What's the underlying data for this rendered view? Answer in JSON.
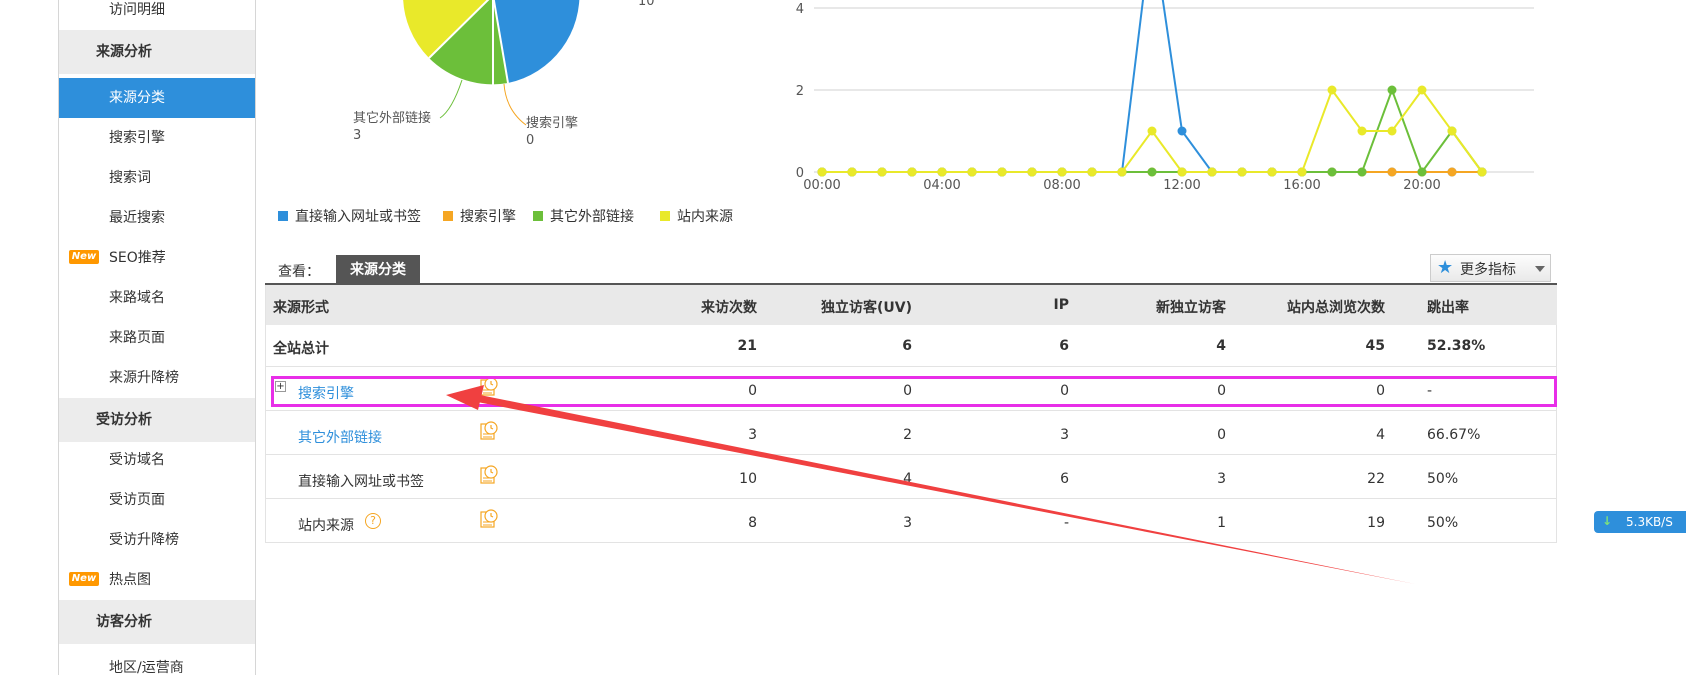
{
  "sidebar": {
    "items": [
      {
        "label": "访问明细",
        "type": "item"
      },
      {
        "label": "来源分析",
        "type": "group"
      },
      {
        "label": "来源分类",
        "type": "active"
      },
      {
        "label": "搜索引擎",
        "type": "item"
      },
      {
        "label": "搜索词",
        "type": "item"
      },
      {
        "label": "最近搜索",
        "type": "item"
      },
      {
        "label": "SEO推荐",
        "type": "new"
      },
      {
        "label": "来路域名",
        "type": "item"
      },
      {
        "label": "来路页面",
        "type": "item"
      },
      {
        "label": "来源升降榜",
        "type": "item"
      },
      {
        "label": "受访分析",
        "type": "group"
      },
      {
        "label": "受访域名",
        "type": "item"
      },
      {
        "label": "受访页面",
        "type": "item"
      },
      {
        "label": "受访升降榜",
        "type": "item"
      },
      {
        "label": "热点图",
        "type": "new"
      },
      {
        "label": "访客分析",
        "type": "group"
      },
      {
        "label": "地区/运营商",
        "type": "item"
      }
    ],
    "new_badge": "New"
  },
  "pie": {
    "labels": [
      {
        "name": "其它外部链接",
        "value": "3"
      },
      {
        "name": "搜索引擎",
        "value": "0"
      },
      {
        "name": "",
        "value": "10"
      }
    ]
  },
  "legend": [
    {
      "label": "直接输入网址或书签",
      "color": "#2e8fdb"
    },
    {
      "label": "搜索引擎",
      "color": "#f5a623"
    },
    {
      "label": "其它外部链接",
      "color": "#6cbf3a"
    },
    {
      "label": "站内来源",
      "color": "#e9e92a"
    }
  ],
  "chart_data": {
    "type": "line",
    "x": [
      "00:00",
      "01:00",
      "02:00",
      "03:00",
      "04:00",
      "05:00",
      "06:00",
      "07:00",
      "08:00",
      "09:00",
      "10:00",
      "11:00",
      "12:00",
      "13:00",
      "14:00",
      "15:00",
      "16:00",
      "17:00",
      "18:00",
      "19:00",
      "20:00",
      "21:00",
      "22:00"
    ],
    "xticks": [
      "00:00",
      "04:00",
      "08:00",
      "12:00",
      "16:00",
      "20:00"
    ],
    "yticks": [
      "0",
      "2",
      "4"
    ],
    "ylim": [
      0,
      4
    ],
    "series": [
      {
        "name": "直接输入网址或书签",
        "color": "#2e8fdb",
        "values": [
          0,
          0,
          0,
          0,
          0,
          0,
          0,
          0,
          0,
          0,
          0,
          6,
          1,
          0,
          0,
          0,
          0,
          0,
          0,
          0,
          0,
          0,
          0
        ]
      },
      {
        "name": "搜索引擎",
        "color": "#f5a623",
        "values": [
          0,
          0,
          0,
          0,
          0,
          0,
          0,
          0,
          0,
          0,
          0,
          0,
          0,
          0,
          0,
          0,
          0,
          0,
          0,
          0,
          0,
          0,
          0
        ]
      },
      {
        "name": "其它外部链接",
        "color": "#6cbf3a",
        "values": [
          0,
          0,
          0,
          0,
          0,
          0,
          0,
          0,
          0,
          0,
          0,
          0,
          0,
          0,
          0,
          0,
          0,
          0,
          0,
          2,
          0,
          1,
          0
        ]
      },
      {
        "name": "站内来源",
        "color": "#e9e92a",
        "values": [
          0,
          0,
          0,
          0,
          0,
          0,
          0,
          0,
          0,
          0,
          0,
          1,
          0,
          0,
          0,
          0,
          0,
          2,
          1,
          1,
          2,
          1,
          0
        ]
      }
    ]
  },
  "view": {
    "label": "查看：",
    "tab": "来源分类",
    "more_btn": "更多指标"
  },
  "table": {
    "headers": [
      "来源形式",
      "来访次数",
      "独立访客(UV)",
      "IP",
      "新独立访客",
      "站内总浏览次数",
      "跳出率"
    ],
    "total": {
      "name": "全站总计",
      "values": [
        "21",
        "6",
        "6",
        "4",
        "45",
        "52.38%"
      ]
    },
    "rows": [
      {
        "name": "搜索引擎",
        "values": [
          "0",
          "0",
          "0",
          "0",
          "0",
          "-"
        ]
      },
      {
        "name": "其它外部链接",
        "values": [
          "3",
          "2",
          "3",
          "0",
          "4",
          "66.67%"
        ]
      },
      {
        "name": "直接输入网址或书签",
        "values": [
          "10",
          "4",
          "6",
          "3",
          "22",
          "50%"
        ]
      },
      {
        "name": "站内来源",
        "values": [
          "8",
          "3",
          "-",
          "1",
          "19",
          "50%"
        ]
      }
    ],
    "expand_sign": "+",
    "help_sign": "?"
  },
  "speed": "5.3KB/S"
}
